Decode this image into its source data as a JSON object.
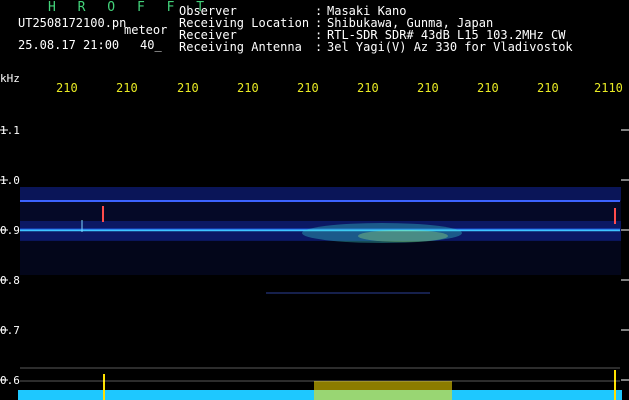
{
  "header": {
    "brand": "H R O F F T",
    "file_name": "UT2508172100.pn",
    "tag": "meteor",
    "date_time": "25.08.17 21:00",
    "count": "40_"
  },
  "meta": {
    "observer_label": "Observer",
    "observer_value": "Masaki Kano",
    "location_label": "Receiving Location",
    "location_value": "Shibukawa, Gunma, Japan",
    "receiver_label": "Receiver",
    "receiver_value": "RTL-SDR SDR# 43dB L15 103.2MHz CW",
    "antenna_label": "Receiving Antenna",
    "antenna_value": "3el Yagi(V) Az 330 for Vladivostok"
  },
  "axis": {
    "y_unit": "kHz",
    "y_ticks": [
      "1.1",
      "1.0",
      "0.9",
      "0.8",
      "0.7",
      "0.6"
    ],
    "x_ticks": [
      "210",
      "210",
      "210",
      "210",
      "210",
      "210",
      "210",
      "210",
      "210",
      "2110"
    ]
  },
  "colors": {
    "background": "#000000",
    "brand": "#43d37a",
    "tick_text": "#e8ea24",
    "signal_low": "#1d2ea7",
    "signal_high": "#3ad6ff",
    "meteor_hit": "#ff4c4c",
    "histogram": "#1ec8ff",
    "histogram_peak": "#ffe100"
  }
}
